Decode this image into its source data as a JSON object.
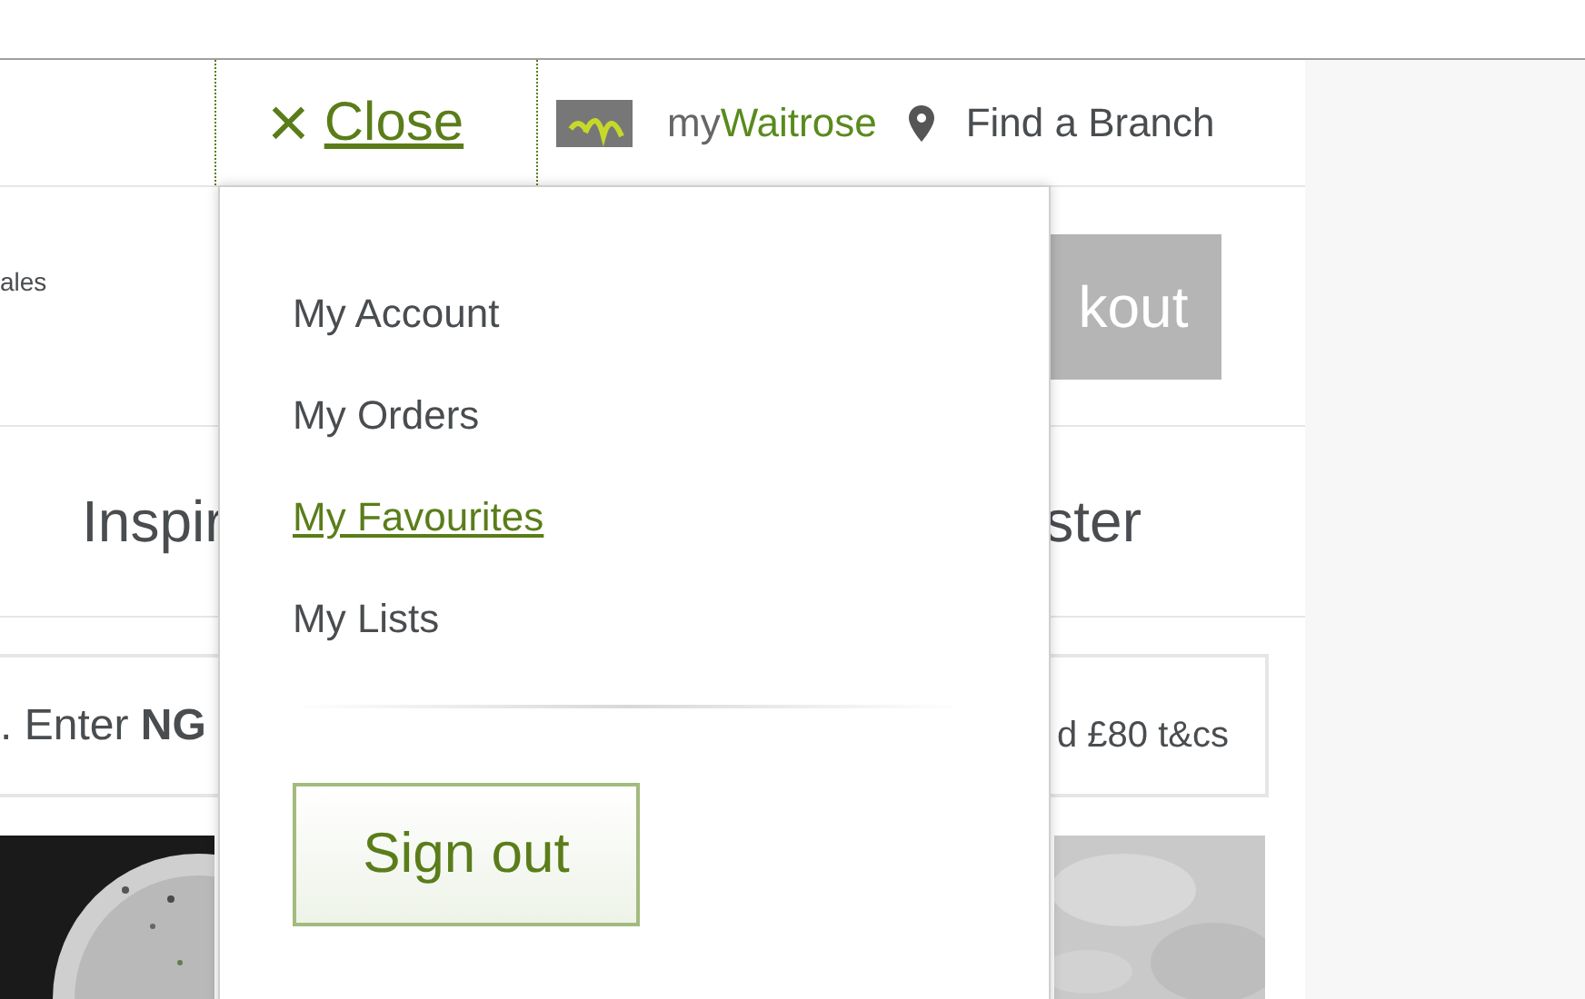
{
  "header": {
    "close_icon": "×",
    "close_label": "Close",
    "brand_prefix": "my",
    "brand_name": "Waitrose",
    "branch_link": "Find a Branch"
  },
  "background": {
    "row_text": "ales",
    "checkout_button": "kout",
    "nav_left": "Inspir",
    "nav_right": "ster",
    "promo_left": ". Enter **NG**",
    "promo_right": "d £80 t&cs"
  },
  "menu": {
    "items": [
      {
        "label": "My Account",
        "selected": false
      },
      {
        "label": "My Orders",
        "selected": false
      },
      {
        "label": "My Favourites",
        "selected": true
      },
      {
        "label": "My Lists",
        "selected": false
      }
    ],
    "sign_out": "Sign out"
  }
}
